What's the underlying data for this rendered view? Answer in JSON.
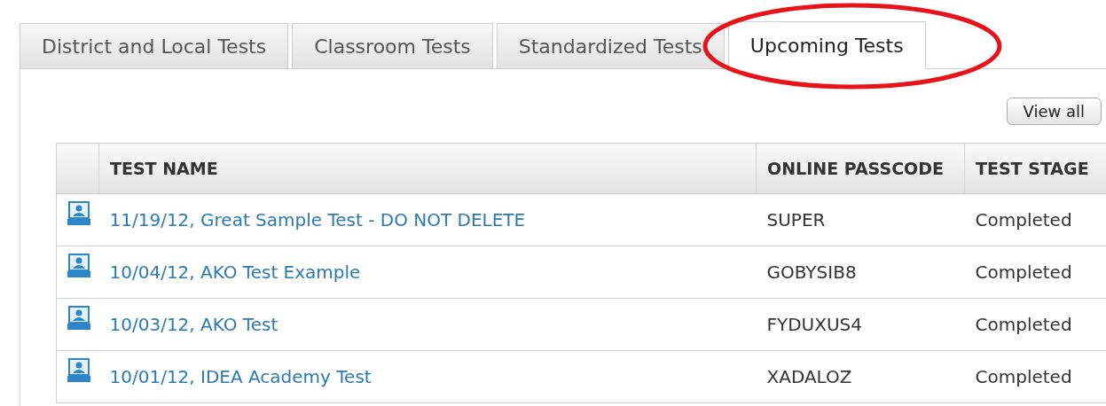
{
  "tabs": [
    {
      "label": "District and Local Tests",
      "selected": false,
      "circled": false
    },
    {
      "label": "Classroom Tests",
      "selected": false,
      "circled": false
    },
    {
      "label": "Standardized Tests",
      "selected": false,
      "circled": false
    },
    {
      "label": "Upcoming Tests",
      "selected": true,
      "circled": true
    }
  ],
  "view_all_button": "View all",
  "table": {
    "columns": [
      "TEST NAME",
      "ONLINE PASSCODE",
      "TEST STAGE"
    ],
    "rows": [
      {
        "test_name": "11/19/12, Great Sample Test - DO NOT DELETE",
        "passcode": "SUPER",
        "stage": "Completed"
      },
      {
        "test_name": "10/04/12, AKO Test Example",
        "passcode": "GOBYSIB8",
        "stage": "Completed"
      },
      {
        "test_name": "10/03/12, AKO Test",
        "passcode": "FYDUXUS4",
        "stage": "Completed"
      },
      {
        "test_name": "10/01/12, IDEA Academy Test",
        "passcode": "XADALOZ",
        "stage": "Completed"
      }
    ]
  }
}
